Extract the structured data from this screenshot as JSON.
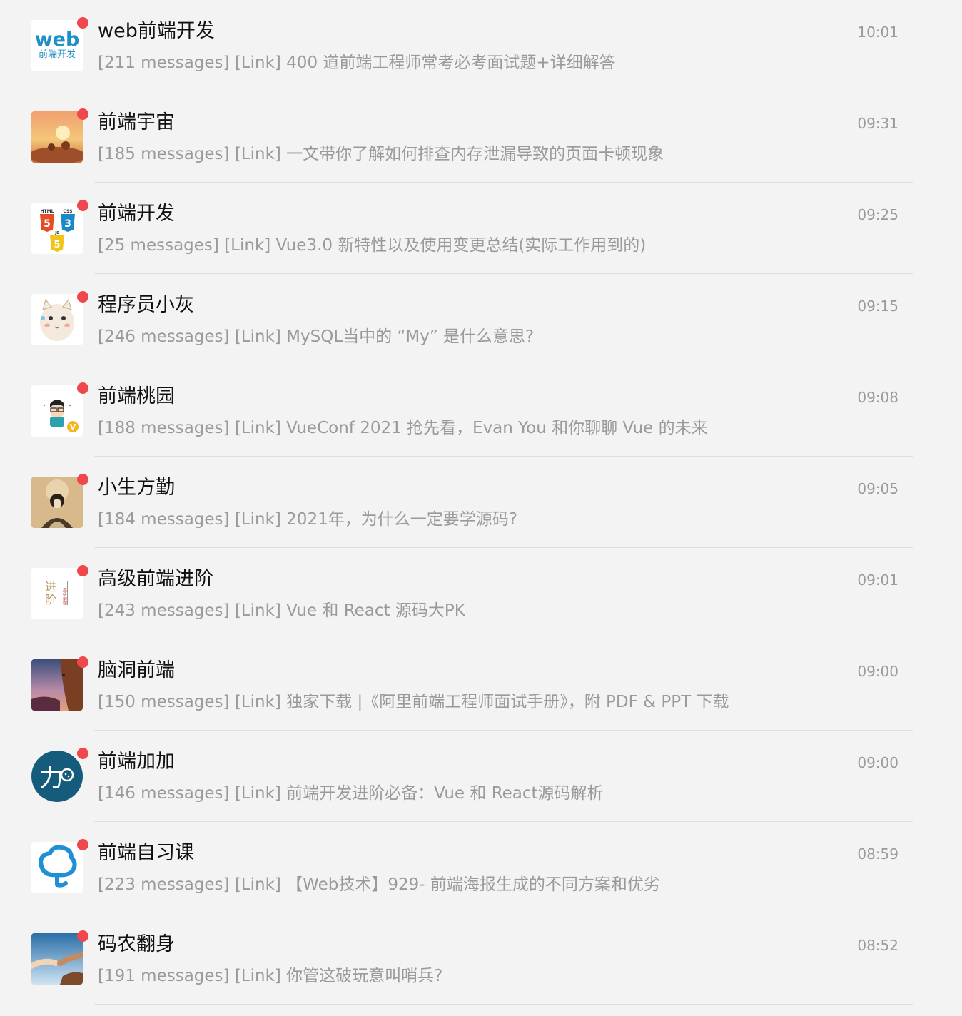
{
  "colors": {
    "background": "#f3f3f3",
    "unread_dot": "#f0474c",
    "name_text": "#111111",
    "secondary_text": "#9a9a9a",
    "separator": "#dedede"
  },
  "chats": [
    {
      "name": "web前端开发",
      "time": "10:01",
      "preview": "[211 messages] [Link] 400 道前端工程师常考必考面试题+详细解答",
      "avatar_icon": "web-logo-icon",
      "avatar_text": [
        "web",
        "前端开发"
      ],
      "unread": true
    },
    {
      "name": "前端宇宙",
      "time": "09:31",
      "preview": "[185 messages] [Link] 一文带你了解如何排查内存泄漏导致的页面卡顿现象",
      "avatar_icon": "sunset-scene-icon",
      "unread": true
    },
    {
      "name": "前端开发",
      "time": "09:25",
      "preview": "[25 messages] [Link] Vue3.0 新特性以及使用变更总结(实际工作用到的)",
      "avatar_icon": "html-css-js-badges-icon",
      "avatar_text": [
        "HTML",
        "CSS",
        "JS",
        "5",
        "3",
        "5"
      ],
      "unread": true
    },
    {
      "name": "程序员小灰",
      "time": "09:15",
      "preview": "[246 messages] [Link] MySQL当中的 “My” 是什么意思?",
      "avatar_icon": "cartoon-cat-icon",
      "unread": true
    },
    {
      "name": "前端桃园",
      "time": "09:08",
      "preview": "[188 messages] [Link] VueConf 2021 抢先看，Evan You 和你聊聊 Vue 的未来",
      "avatar_icon": "programmer-cartoon-icon",
      "avatar_text": [
        "V"
      ],
      "unread": true
    },
    {
      "name": "小生方勤",
      "time": "09:05",
      "preview": "[184 messages] [Link] 2021年，为什么一定要学源码?",
      "avatar_icon": "portrait-illustration-icon",
      "unread": true
    },
    {
      "name": "高级前端进阶",
      "time": "09:01",
      "preview": "[243 messages] [Link] Vue 和 React 源码大PK",
      "avatar_icon": "jinjie-calligraphy-icon",
      "avatar_text": [
        "进",
        "阶",
        "高级前端"
      ],
      "unread": true
    },
    {
      "name": "脑洞前端",
      "time": "09:00",
      "preview": "[150 messages] [Link] 独家下载 |《阿里前端工程师面试手册》，附 PDF & PPT 下载",
      "avatar_icon": "cliff-climber-icon",
      "unread": true
    },
    {
      "name": "前端加加",
      "time": "09:00",
      "preview": "[146 messages] [Link] 前端开发进阶必备：Vue 和 React源码解析",
      "avatar_icon": "jia-circle-logo-icon",
      "avatar_text": [
        "力"
      ],
      "unread": true
    },
    {
      "name": "前端自习课",
      "time": "08:59",
      "preview": "[223 messages] [Link] 【Web技术】929- 前端海报生成的不同方案和优劣",
      "avatar_icon": "blue-tree-logo-icon",
      "unread": true
    },
    {
      "name": "码农翻身",
      "time": "08:52",
      "preview": "[191 messages] [Link] 你管这破玩意叫哨兵?",
      "avatar_icon": "helping-hands-icon",
      "unread": true
    }
  ]
}
